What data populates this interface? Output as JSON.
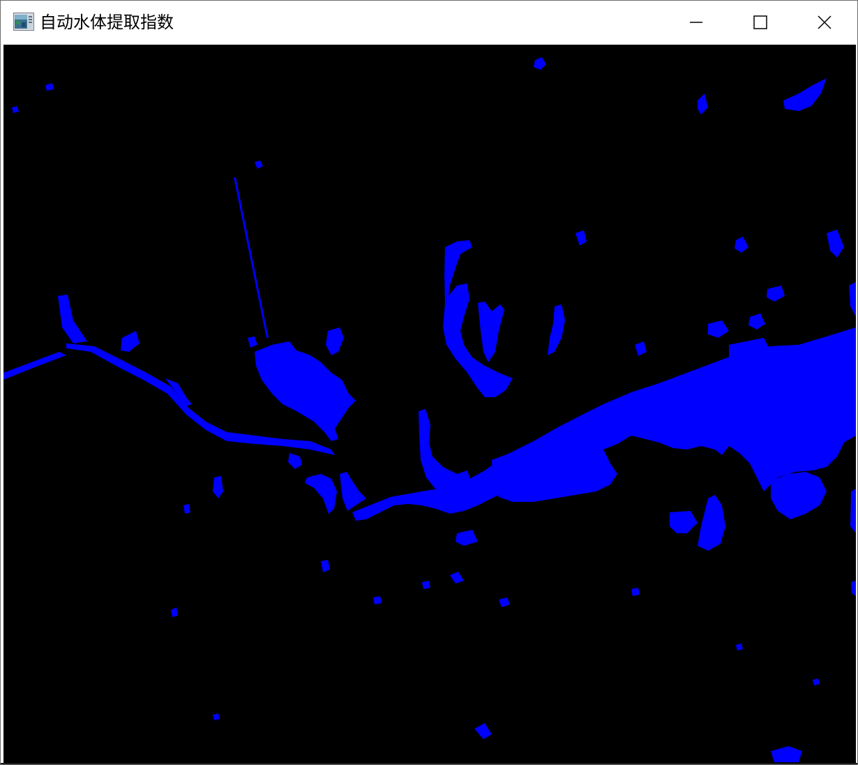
{
  "window": {
    "title": "自动水体提取指数",
    "controls": {
      "minimize_icon": "minimize-icon",
      "maximize_icon": "maximize-icon",
      "close_icon": "close-icon"
    }
  },
  "image": {
    "description_role": "water-extraction-result",
    "background_color": "#000000",
    "water_color": "#0000ff"
  }
}
